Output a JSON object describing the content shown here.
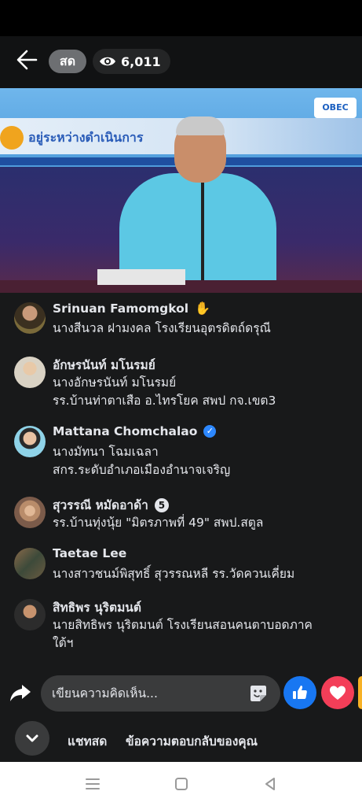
{
  "header": {
    "live_label": "สด",
    "viewer_count": "6,011"
  },
  "video": {
    "banner_text": "อยู่ระหว่างดำเนินการ",
    "logo_text": "OBEC"
  },
  "comments": [
    {
      "name": "Srinuan Famomgkol",
      "lines": [
        "นางสีนวล  ฝามงคล โรงเรียนอุตรดิตถ์ดรุณี"
      ]
    },
    {
      "name": "อักษรนันท์ มโนรมย์",
      "lines": [
        "นางอักษรนันท์  มโนรมย์",
        "รร.บ้านท่าตาเสือ อ.ไทรโยค สพป กจ.เขต3"
      ]
    },
    {
      "name": "Mattana Chomchalao",
      "lines": [
        "นางมัทนา   โฉมเฉลา",
        "สกร.ระดับอำเภอเมืองอำนาจเจริญ"
      ]
    },
    {
      "name": "สุวรรณี หมัดอาด้า",
      "badge": "5",
      "lines": [
        "รร.บ้านทุ่งนุ้ย \"มิตรภาพที่ 49\" สพป.สตูล"
      ]
    },
    {
      "name": "Taetae Lee",
      "lines": [
        "นางสาวชนม์พิสุทธิ์  สุวรรณหลี  รร.วัดควนเคี่ยม"
      ]
    },
    {
      "name": "สิทธิพร นุริตมนต์",
      "lines": [
        "นายสิทธิพร นุริตมนต์ โรงเรียนสอนคนตาบอดภาค",
        "ใต้ฯ"
      ]
    }
  ],
  "composer": {
    "placeholder": "เขียนความคิดเห็น..."
  },
  "tabs": {
    "live_chat": "แชทสด",
    "replies": "ข้อความตอบกลับของคุณ"
  },
  "colors": {
    "like": "#1877f2",
    "love": "#f33e58"
  }
}
